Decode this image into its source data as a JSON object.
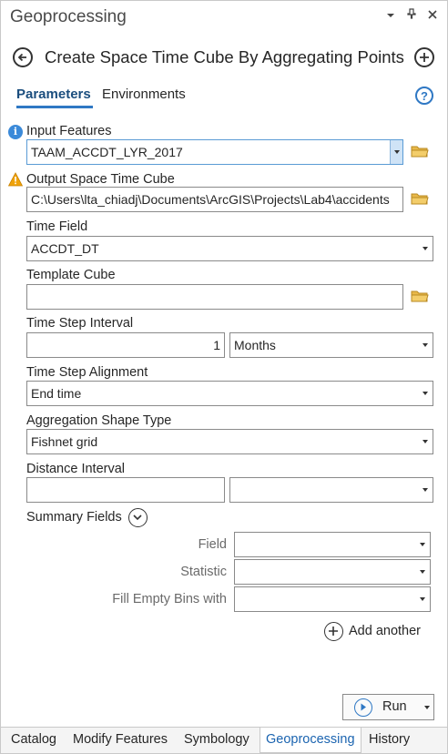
{
  "window": {
    "title": "Geoprocessing",
    "icons": [
      "chevron-down-icon",
      "pin-icon",
      "close-icon"
    ]
  },
  "tool": {
    "title": "Create Space Time Cube By Aggregating Points"
  },
  "tabs": {
    "parameters": "Parameters",
    "environments": "Environments"
  },
  "params": {
    "input_features": {
      "label": "Input Features",
      "value": "TAAM_ACCDT_LYR_2017"
    },
    "output_cube": {
      "label": "Output Space Time Cube",
      "value": "C:\\Users\\lta_chiadj\\Documents\\ArcGIS\\Projects\\Lab4\\accidents"
    },
    "time_field": {
      "label": "Time Field",
      "value": "ACCDT_DT"
    },
    "template_cube": {
      "label": "Template Cube",
      "value": ""
    },
    "time_step_interval": {
      "label": "Time Step Interval",
      "value": "1",
      "unit": "Months"
    },
    "time_step_alignment": {
      "label": "Time Step Alignment",
      "value": "End time"
    },
    "aggregation_shape": {
      "label": "Aggregation Shape Type",
      "value": "Fishnet grid"
    },
    "distance_interval": {
      "label": "Distance Interval",
      "value": "",
      "unit": ""
    }
  },
  "summary": {
    "label": "Summary Fields",
    "field_label": "Field",
    "statistic_label": "Statistic",
    "fill_label": "Fill Empty Bins with",
    "add_another": "Add another"
  },
  "run": {
    "label": "Run"
  },
  "bottom_tabs": [
    "Catalog",
    "Modify Features",
    "Symbology",
    "Geoprocessing",
    "History"
  ],
  "colors": {
    "accent": "#2f78c4",
    "info": "#3b8ad9",
    "warning": "#f0a30a",
    "folder": "#e8b84a"
  }
}
